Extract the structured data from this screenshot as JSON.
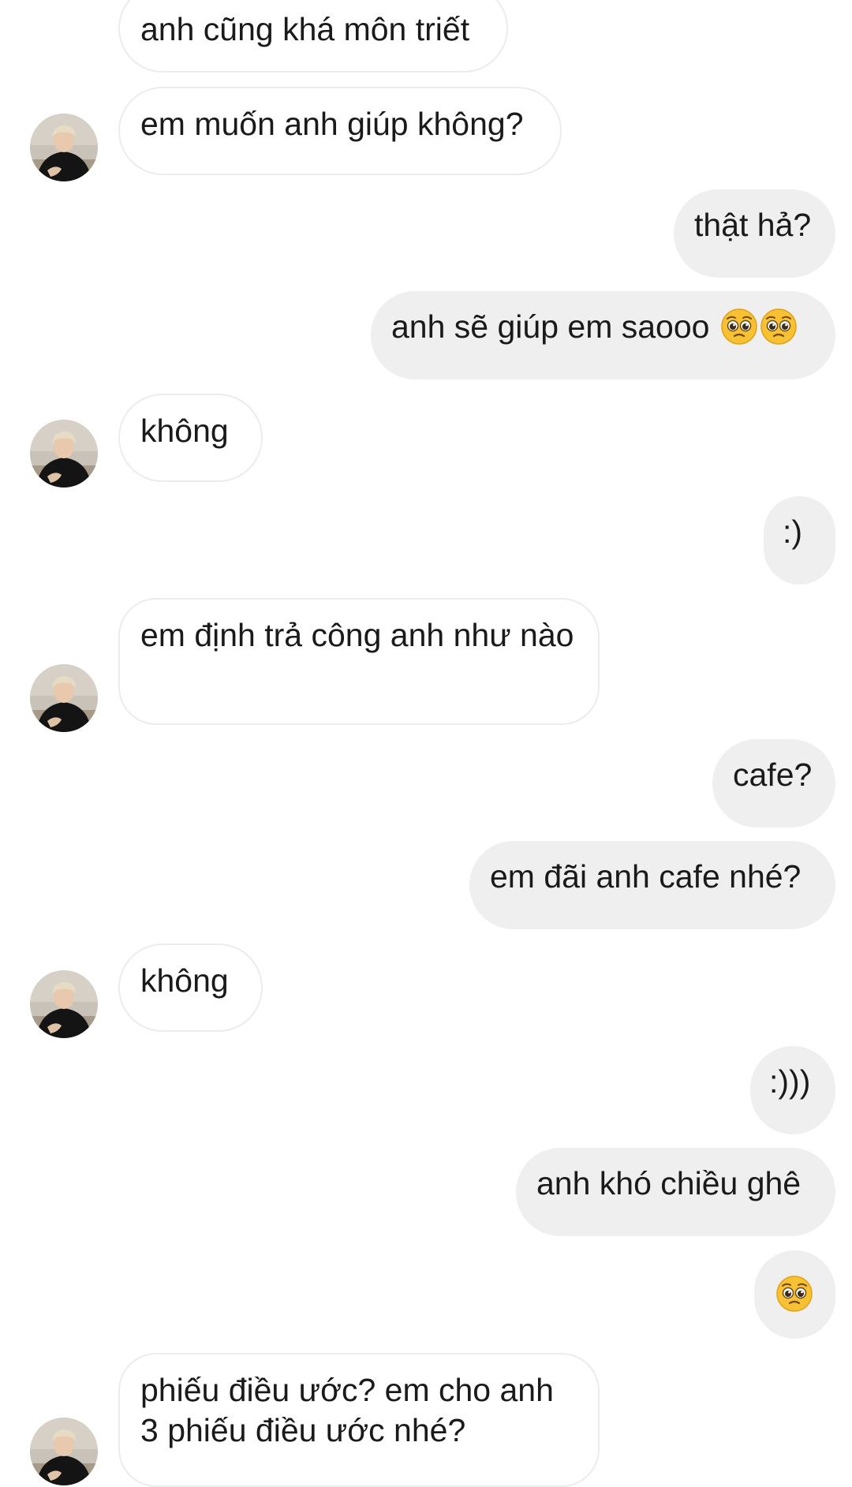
{
  "chat": {
    "messages": [
      {
        "from": "other",
        "text": "anh cũng khá môn triết",
        "avatar": false
      },
      {
        "from": "other",
        "text": "em muốn anh giúp không?",
        "avatar": true
      },
      {
        "from": "me",
        "text": "thật hả?"
      },
      {
        "from": "me",
        "text": "anh sẽ giúp em saooo",
        "emojis": [
          "pleading-face-emoji",
          "pleading-face-emoji"
        ]
      },
      {
        "from": "other",
        "text": "không",
        "avatar": true
      },
      {
        "from": "me",
        "text": ":)"
      },
      {
        "from": "other",
        "text": "em định trả công anh như nào",
        "avatar": true
      },
      {
        "from": "me",
        "text": "cafe?"
      },
      {
        "from": "me",
        "text": "em đãi anh cafe nhé?"
      },
      {
        "from": "other",
        "text": "không",
        "avatar": true
      },
      {
        "from": "me",
        "text": ":)))"
      },
      {
        "from": "me",
        "text": "anh khó chiều ghê"
      },
      {
        "from": "me",
        "text": "",
        "emojis": [
          "pleading-face-emoji"
        ]
      },
      {
        "from": "other",
        "text": "phiếu điều ước? em cho anh 3 phiếu điều ước nhé?",
        "avatar": true
      }
    ]
  },
  "colors": {
    "incoming_bubble": "#ffffff",
    "incoming_border": "#ececec",
    "outgoing_bubble": "#efefef",
    "text": "#1a1a1a"
  }
}
